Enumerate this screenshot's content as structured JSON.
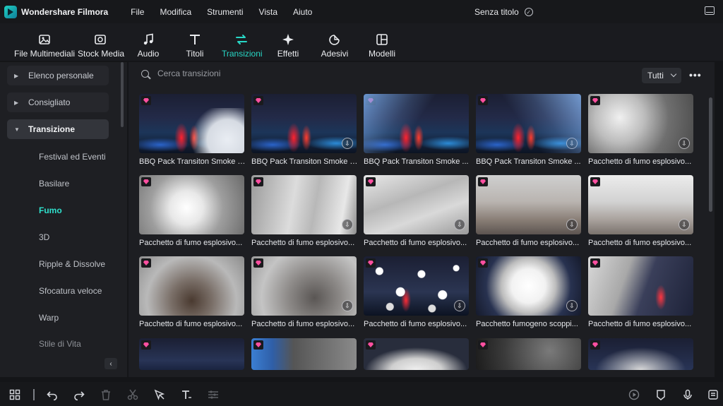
{
  "app": {
    "name": "Wondershare Filmora",
    "document_title": "Senza titolo",
    "accent_color": "#28d7c6"
  },
  "menu": [
    "File",
    "Modifica",
    "Strumenti",
    "Vista",
    "Aiuto"
  ],
  "toolbar": {
    "tabs": [
      {
        "label": "File Multimediali",
        "icon": "media-icon"
      },
      {
        "label": "Stock Media",
        "icon": "stock-media-icon"
      },
      {
        "label": "Audio",
        "icon": "music-note-icon"
      },
      {
        "label": "Titoli",
        "icon": "text-icon"
      },
      {
        "label": "Transizioni",
        "icon": "transition-icon",
        "active": true
      },
      {
        "label": "Effetti",
        "icon": "sparkle-icon"
      },
      {
        "label": "Adesivi",
        "icon": "sticker-icon"
      },
      {
        "label": "Modelli",
        "icon": "template-icon"
      }
    ]
  },
  "sidebar": {
    "groups": [
      {
        "label": "Elenco personale",
        "expanded": false
      },
      {
        "label": "Consigliato",
        "expanded": false
      },
      {
        "label": "Transizione",
        "expanded": true
      }
    ],
    "subitems": [
      {
        "label": "Festival ed Eventi"
      },
      {
        "label": "Basilare"
      },
      {
        "label": "Fumo",
        "active": true
      },
      {
        "label": "3D"
      },
      {
        "label": "Ripple & Dissolve"
      },
      {
        "label": "Sfocatura veloce"
      },
      {
        "label": "Warp"
      },
      {
        "label": "Stile di Vita"
      }
    ],
    "collapse_label": "‹"
  },
  "browser": {
    "search_placeholder": "Cerca transizioni",
    "filter_value": "Tutti",
    "more_label": "•••",
    "items": [
      {
        "name": "BBQ Pack Transiton Smoke L...",
        "style": "t-night t-smoke-right",
        "downloadable": false
      },
      {
        "name": "BBQ Pack Transiton Smoke L...",
        "style": "t-night",
        "downloadable": true
      },
      {
        "name": "BBQ Pack Transiton Smoke ...",
        "style": "t-night t-blue-streak",
        "downloadable": false
      },
      {
        "name": "BBQ Pack Transiton Smoke ...",
        "style": "t-night t-blue-right",
        "downloadable": true
      },
      {
        "name": "Pacchetto di fumo esplosivo...",
        "style": "t-gray",
        "downloadable": true
      },
      {
        "name": "Pacchetto di fumo esplosivo...",
        "style": "t-gray2",
        "downloadable": false
      },
      {
        "name": "Pacchetto di fumo esplosivo...",
        "style": "t-wisp",
        "downloadable": true
      },
      {
        "name": "Pacchetto di fumo esplosivo...",
        "style": "t-wisp2",
        "downloadable": true
      },
      {
        "name": "Pacchetto di fumo esplosivo...",
        "style": "t-haze",
        "downloadable": true
      },
      {
        "name": "Pacchetto di fumo esplosivo...",
        "style": "t-haze2",
        "downloadable": true
      },
      {
        "name": "Pacchetto di fumo esplosivo...",
        "style": "t-dark",
        "downloadable": false
      },
      {
        "name": "Pacchetto di fumo esplosivo...",
        "style": "t-dark2",
        "downloadable": true
      },
      {
        "name": "Pacchetto di fumo esplosivo...",
        "style": "t-bubbles",
        "downloadable": true
      },
      {
        "name": "Pacchetto fumogeno scoppi...",
        "style": "t-burst",
        "downloadable": true
      },
      {
        "name": "Pacchetto di fumo esplosivo...",
        "style": "t-tornado",
        "downloadable": false
      },
      {
        "name": "",
        "style": "t-partial",
        "downloadable": false
      },
      {
        "name": "",
        "style": "t-partial-blue",
        "downloadable": false
      },
      {
        "name": "",
        "style": "t-partial-white",
        "downloadable": false
      },
      {
        "name": "",
        "style": "t-partial-dark",
        "downloadable": false
      },
      {
        "name": "",
        "style": "t-partial-smoke",
        "downloadable": false
      }
    ]
  },
  "bottombar": {
    "icons": [
      "layout-icon",
      "undo-icon",
      "redo-icon",
      "delete-icon",
      "cut-icon",
      "select-icon",
      "text-tool-icon",
      "adjust-icon",
      "render-icon",
      "marker-icon",
      "mic-icon",
      "more-settings-icon"
    ]
  }
}
